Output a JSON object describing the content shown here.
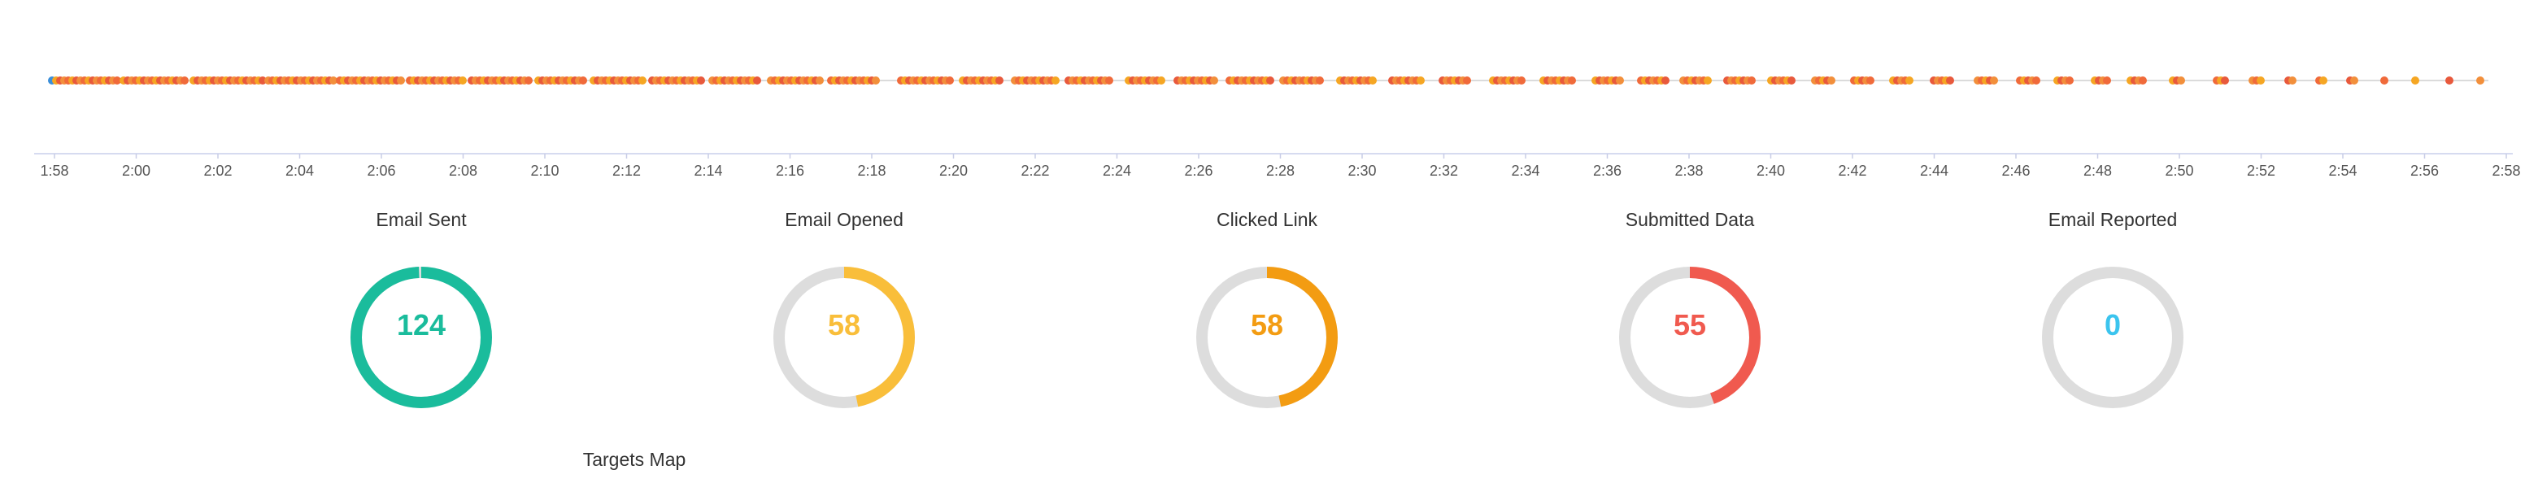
{
  "timeline": {
    "tick_labels": [
      "1:58",
      "2:00",
      "2:02",
      "2:04",
      "2:06",
      "2:08",
      "2:10",
      "2:12",
      "2:14",
      "2:16",
      "2:18",
      "2:20",
      "2:22",
      "2:24",
      "2:26",
      "2:28",
      "2:30",
      "2:32",
      "2:34",
      "2:36",
      "2:38",
      "2:40",
      "2:42",
      "2:44",
      "2:46",
      "2:48",
      "2:50",
      "2:52",
      "2:54",
      "2:56",
      "2:58"
    ],
    "event_colors": [
      "#f06a3a",
      "#f5a623",
      "#e8593c",
      "#f28f3b"
    ],
    "first_event_color": "#3b8fd9"
  },
  "stats": [
    {
      "title": "Email Sent",
      "value": "124",
      "color": "#1abc9c",
      "fraction": 1.0
    },
    {
      "title": "Email Opened",
      "value": "58",
      "color": "#f9be3a",
      "fraction": 0.468
    },
    {
      "title": "Clicked Link",
      "value": "58",
      "color": "#f39c12",
      "fraction": 0.468
    },
    {
      "title": "Submitted Data",
      "value": "55",
      "color": "#f05a4f",
      "fraction": 0.444
    },
    {
      "title": "Email Reported",
      "value": "0",
      "color": "#3bc4ee",
      "fraction": 0.0
    }
  ],
  "track_color": "#dddddd",
  "map": {
    "title": "Targets Map"
  }
}
